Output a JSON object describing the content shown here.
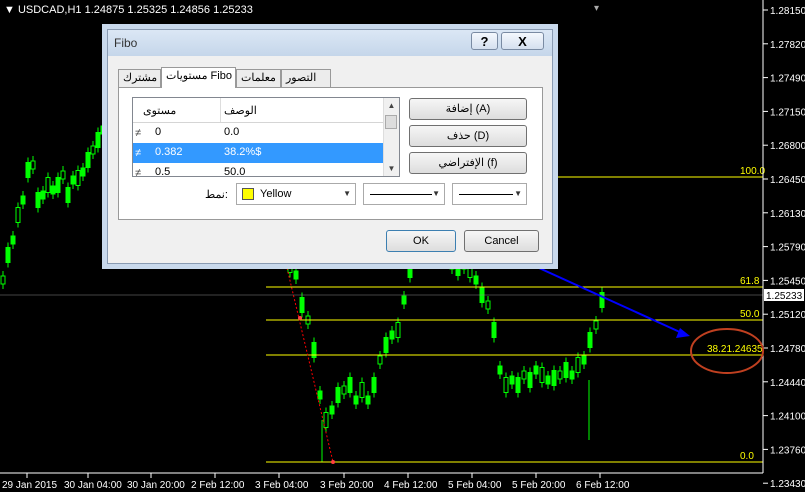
{
  "chart": {
    "symbol": "USDCAD,H1",
    "prices": [
      "1.24875",
      "1.25325",
      "1.24856",
      "1.25233"
    ],
    "current_price": "1.25233",
    "price_ticks": [
      "1.28150",
      "1.27820",
      "1.27490",
      "1.27150",
      "1.26800",
      "1.26450",
      "1.26130",
      "1.25790",
      "1.25450",
      "1.25120",
      "1.24780",
      "1.24440",
      "1.24100",
      "1.23760",
      "1.23430"
    ],
    "time_ticks": [
      "29 Jan 2015",
      "30 Jan 04:00",
      "30 Jan 20:00",
      "2 Feb 12:00",
      "3 Feb 04:00",
      "3 Feb 20:00",
      "4 Feb 12:00",
      "5 Feb 04:00",
      "5 Feb 20:00",
      "6 Feb 12:00"
    ],
    "fib_labels": [
      "100.0",
      "61.8",
      "50.0",
      "38.21.24635",
      "0.0"
    ],
    "colors": {
      "candle": "#00ff00",
      "fib": "#ffff00",
      "grid": "#ffffff",
      "trend": "#ff0000",
      "annotation_arrow": "#0000ff",
      "annotation_circle": "#c04020"
    }
  },
  "dialog": {
    "title": "Fibo",
    "help_label": "?",
    "close_label": "X",
    "tabs": [
      "مشترك",
      "مستويات Fibo",
      "معلمات",
      "التصور"
    ],
    "list": {
      "headers": {
        "level": "مستوى",
        "description": "الوصف"
      },
      "rows": [
        {
          "icon": "≠",
          "level": "0",
          "description": "0.0"
        },
        {
          "icon": "≠",
          "level": "0.382",
          "description": "38.2%$"
        },
        {
          "icon": "≠",
          "level": "0.5",
          "description": "50.0"
        }
      ]
    },
    "buttons": {
      "add": "إضافة (A)",
      "delete": "حذف (D)",
      "defaults": "الإفتراضي (f)"
    },
    "style_label": "نمط:",
    "color_value": "Yellow",
    "ok": "OK",
    "cancel": "Cancel"
  }
}
